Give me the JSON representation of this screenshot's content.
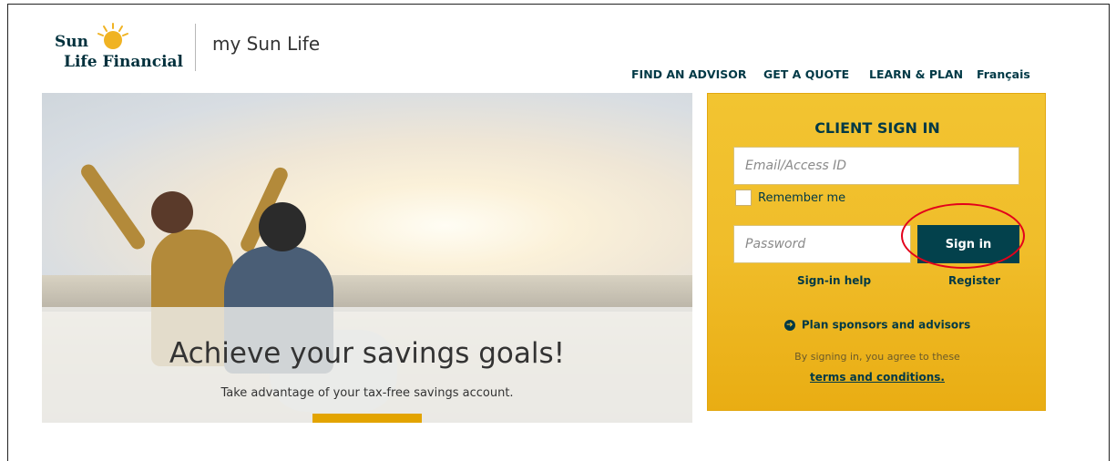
{
  "brand": {
    "logo_line1": "Sun",
    "logo_line2": "Life Financial",
    "app_title": "my Sun Life"
  },
  "topnav": {
    "items": [
      {
        "label": "FIND AN ADVISOR"
      },
      {
        "label": "GET A QUOTE"
      },
      {
        "label": "LEARN & PLAN"
      },
      {
        "label": "Français"
      }
    ]
  },
  "hero": {
    "headline": "Achieve your savings goals!",
    "subtext": "Take advantage of your tax-free savings account."
  },
  "signin": {
    "title": "CLIENT SIGN IN",
    "email_placeholder": "Email/Access ID",
    "remember_label": "Remember me",
    "password_placeholder": "Password",
    "button_label": "Sign in",
    "help_link": "Sign-in help",
    "register_link": "Register",
    "plan_link": "Plan sponsors and advisors",
    "terms_note": "By signing in, you agree to these",
    "terms_link": "terms and conditions."
  },
  "colors": {
    "panel": "#f0bd2a",
    "button": "#03414c",
    "text_dark": "#003946",
    "highlight": "#e3001b"
  },
  "icons": {
    "plan_link_icon": "circle-arrow-right-icon",
    "logo_icon": "sun-logo-icon"
  }
}
